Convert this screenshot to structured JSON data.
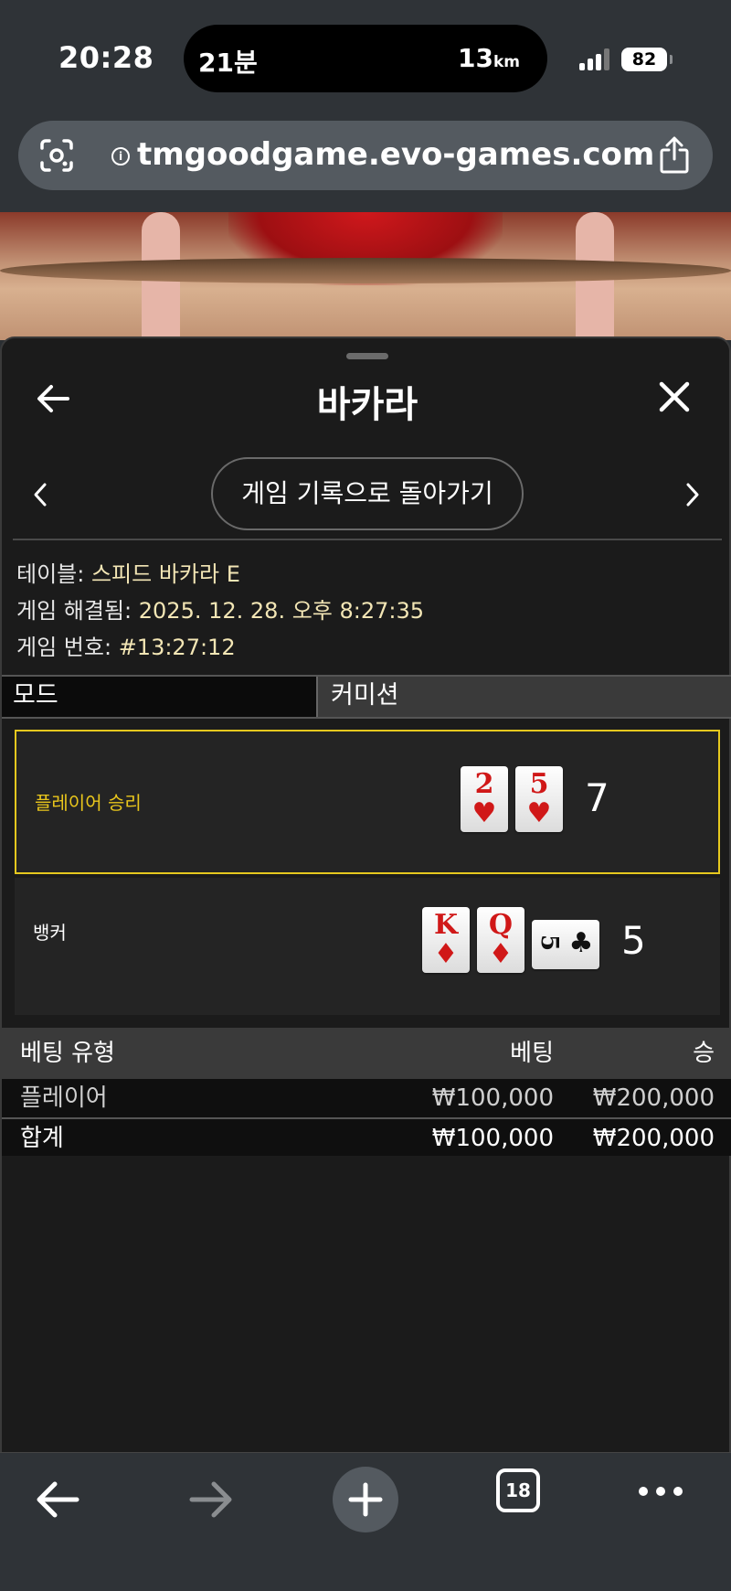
{
  "status_bar": {
    "time": "20:28",
    "island_left": "21분",
    "island_right_value": "13",
    "island_right_unit": "km",
    "battery": "82"
  },
  "browser": {
    "url": "tmgoodgame.evo-games.com"
  },
  "panel": {
    "title": "바카라",
    "history_button": "게임 기록으로 돌아가기",
    "table_label": "테이블:",
    "table_value": "스피드 바카라 E",
    "resolved_label": "게임 해결됨:",
    "resolved_value": "2025. 12. 28. 오후 8:27:35",
    "game_no_label": "게임 번호:",
    "game_no_value": "#13:27:12",
    "tabs": {
      "mode": "모드",
      "commission": "커미션"
    },
    "player": {
      "label": "플레이어 승리",
      "score": "7",
      "cards": [
        {
          "rank": "2",
          "suit": "♥"
        },
        {
          "rank": "5",
          "suit": "♥"
        }
      ]
    },
    "banker": {
      "label": "뱅커",
      "score": "5",
      "cards": [
        {
          "rank": "K",
          "suit": "♦"
        },
        {
          "rank": "Q",
          "suit": "♦"
        },
        {
          "rank": "5",
          "suit": "♣"
        }
      ]
    },
    "bets": {
      "headers": {
        "type": "베팅 유형",
        "bet": "베팅",
        "win": "승"
      },
      "rows": [
        {
          "type": "플레이어",
          "bet": "₩100,000",
          "win": "₩200,000"
        }
      ],
      "total": {
        "type": "합계",
        "bet": "₩100,000",
        "win": "₩200,000"
      }
    }
  },
  "toolbar": {
    "tab_count": "18"
  },
  "colors": {
    "accent_yellow": "#e6c81e",
    "card_red": "#d01818",
    "panel_bg": "#1b1b1b"
  },
  "icons": [
    "lens-icon",
    "info-icon",
    "share-icon",
    "back-arrow-icon",
    "close-icon",
    "chevron-left-icon",
    "chevron-right-icon",
    "browser-back-icon",
    "browser-forward-icon",
    "new-tab-plus-icon",
    "tabs-count-icon",
    "more-dots-icon"
  ]
}
